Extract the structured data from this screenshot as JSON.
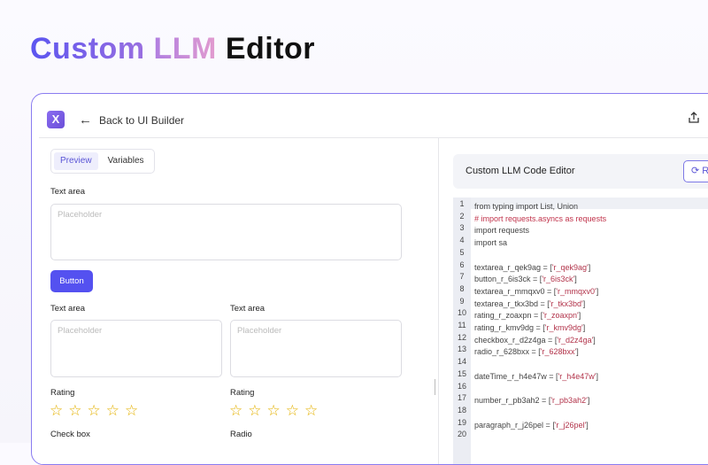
{
  "page_title": {
    "part1": "Custom",
    "part2": "LLM",
    "part3": "Editor"
  },
  "topbar": {
    "logo": "X",
    "back_label": "Back to UI Builder"
  },
  "tabs": [
    {
      "label": "Preview",
      "active": true
    },
    {
      "label": "Variables",
      "active": false
    }
  ],
  "preview": {
    "textarea1": {
      "label": "Text area",
      "placeholder": "Placeholder"
    },
    "button_label": "Button",
    "textarea2": {
      "label": "Text area",
      "placeholder": "Placeholder"
    },
    "textarea3": {
      "label": "Text area",
      "placeholder": "Placeholder"
    },
    "rating1": {
      "label": "Rating",
      "value": 0,
      "max": 5
    },
    "rating2": {
      "label": "Rating",
      "value": 0,
      "max": 5
    },
    "checkbox_label": "Check box",
    "radio_label": "Radio"
  },
  "code_editor": {
    "title": "Custom LLM Code Editor",
    "refresh_label": "R",
    "lines": [
      {
        "n": "1",
        "code": "from typing import List, Union",
        "str": ""
      },
      {
        "n": "2",
        "code": "",
        "str": "",
        "comment": "# import requests.asyncs as requests"
      },
      {
        "n": "3",
        "code": "import requests",
        "str": ""
      },
      {
        "n": "4",
        "code": "import sa",
        "str": ""
      },
      {
        "n": "5",
        "code": "",
        "str": ""
      },
      {
        "n": "6",
        "code": "textarea_r_qek9ag = [",
        "str": "'r_qek9ag'"
      },
      {
        "n": "7",
        "code": "button_r_6is3ck = [",
        "str": "'r_6is3ck'"
      },
      {
        "n": "8",
        "code": "textarea_r_mmqxv0 = [",
        "str": "'r_mmqxv0'"
      },
      {
        "n": "9",
        "code": "textarea_r_tkx3bd = [",
        "str": "'r_tkx3bd'"
      },
      {
        "n": "10",
        "code": "rating_r_zoaxpn = [",
        "str": "'r_zoaxpn'"
      },
      {
        "n": "11",
        "code": "rating_r_kmv9dg = [",
        "str": "'r_kmv9dg'"
      },
      {
        "n": "12",
        "code": "checkbox_r_d2z4ga = [",
        "str": "'r_d2z4ga'"
      },
      {
        "n": "13",
        "code": "radio_r_628bxx = [",
        "str": "'r_628bxx'"
      },
      {
        "n": "14",
        "code": "",
        "str": ""
      },
      {
        "n": "15",
        "code": "dateTime_r_h4e47w = [",
        "str": "'r_h4e47w'"
      },
      {
        "n": "16",
        "code": "",
        "str": ""
      },
      {
        "n": "17",
        "code": "number_r_pb3ah2 = [",
        "str": "'r_pb3ah2'"
      },
      {
        "n": "18",
        "code": "",
        "str": ""
      },
      {
        "n": "19",
        "code": "paragraph_r_j26pel = [",
        "str": "'r_j26pel'"
      },
      {
        "n": "20",
        "code": "",
        "str": ""
      }
    ]
  }
}
